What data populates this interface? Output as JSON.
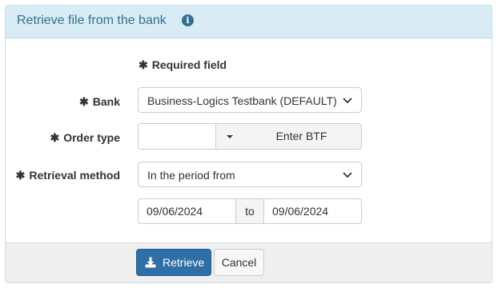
{
  "panel": {
    "title": "Retrieve file from the bank",
    "info_icon": "info-icon"
  },
  "form": {
    "required_note": "Required field",
    "required_marker": "✱",
    "bank": {
      "label": "Bank",
      "value": "Business-Logics Testbank (DEFAULT)"
    },
    "order_type": {
      "label": "Order type",
      "value": "",
      "button_label": "Enter BTF"
    },
    "retrieval_method": {
      "label": "Retrieval method",
      "value": "In the period from"
    },
    "date_from": "09/06/2024",
    "date_to_label": "to",
    "date_to": "09/06/2024"
  },
  "footer": {
    "retrieve_label": "Retrieve",
    "cancel_label": "Cancel"
  },
  "colors": {
    "header_bg": "#d9ecf5",
    "header_text": "#31708f",
    "primary": "#2f6fa7"
  }
}
